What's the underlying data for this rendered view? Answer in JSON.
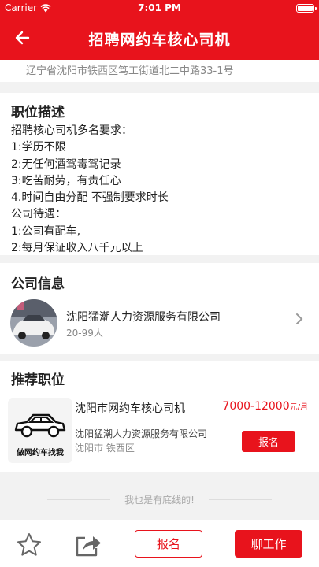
{
  "status_bar": {
    "carrier": "Carrier",
    "time": "7:01 PM"
  },
  "nav": {
    "title": "招聘网约车核心司机",
    "back_icon": "back-arrow-icon"
  },
  "address": {
    "text": "辽宁省沈阳市铁西区笃工街道北二中路33-1号"
  },
  "description": {
    "title": "职位描述",
    "lines": [
      "招聘核心司机多名要求：",
      "1:学历不限",
      "2:无任何酒驾毒驾记录",
      "3:吃苦耐劳，有责任心",
      "4.时间自由分配  不强制要求时长",
      "公司待遇：",
      "1:公司有配车,",
      "2:每月保证收入八千元以上"
    ]
  },
  "company": {
    "title": "公司信息",
    "name": "沈阳猛潮人力资源服务有限公司",
    "size": "20-99人"
  },
  "recommend": {
    "title": "推荐职位",
    "job": {
      "title": "沈阳市网约车核心司机",
      "salary": "7000-12000",
      "salary_unit": "元/月",
      "company": "沈阳猛潮人力资源服务有限公司",
      "location": "沈阳市 铁西区",
      "thumb_text": "做网约车找我",
      "apply_label": "报名"
    }
  },
  "footer": {
    "end_text": "我也是有底线的!"
  },
  "tabbar": {
    "apply_label": "报名",
    "chat_label": "聊工作",
    "icons": [
      "star-icon",
      "share-icon"
    ]
  },
  "colors": {
    "brand": "#e8131c"
  }
}
